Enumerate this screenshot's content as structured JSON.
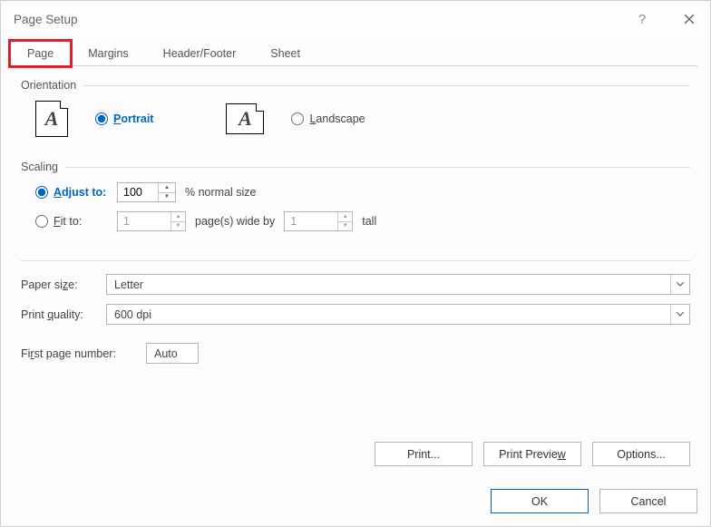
{
  "title": "Page Setup",
  "tabs": {
    "page": "Page",
    "margins": "Margins",
    "headerfooter": "Header/Footer",
    "sheet": "Sheet"
  },
  "orientation": {
    "header": "Orientation",
    "portrait": "Portrait",
    "landscape": "Landscape",
    "selected": "portrait"
  },
  "scaling": {
    "header": "Scaling",
    "adjust_label_pre": "A",
    "adjust_label_post": "djust to:",
    "adjust_value": "100",
    "adjust_unit": "% normal size",
    "fit_label_pre": "F",
    "fit_label_post": "it to:",
    "fit_wide_value": "1",
    "fit_wide_label": "page(s) wide by",
    "fit_tall_value": "1",
    "fit_tall_label": "tall",
    "selected": "adjust"
  },
  "paper": {
    "size_label": "Paper size:",
    "size_value": "Letter",
    "quality_label": "Print quality:",
    "quality_value": "600 dpi",
    "firstpage_label": "First page number:",
    "firstpage_value": "Auto"
  },
  "buttons": {
    "print": "Print...",
    "preview": "Print Preview",
    "options": "Options...",
    "ok": "OK",
    "cancel": "Cancel"
  }
}
